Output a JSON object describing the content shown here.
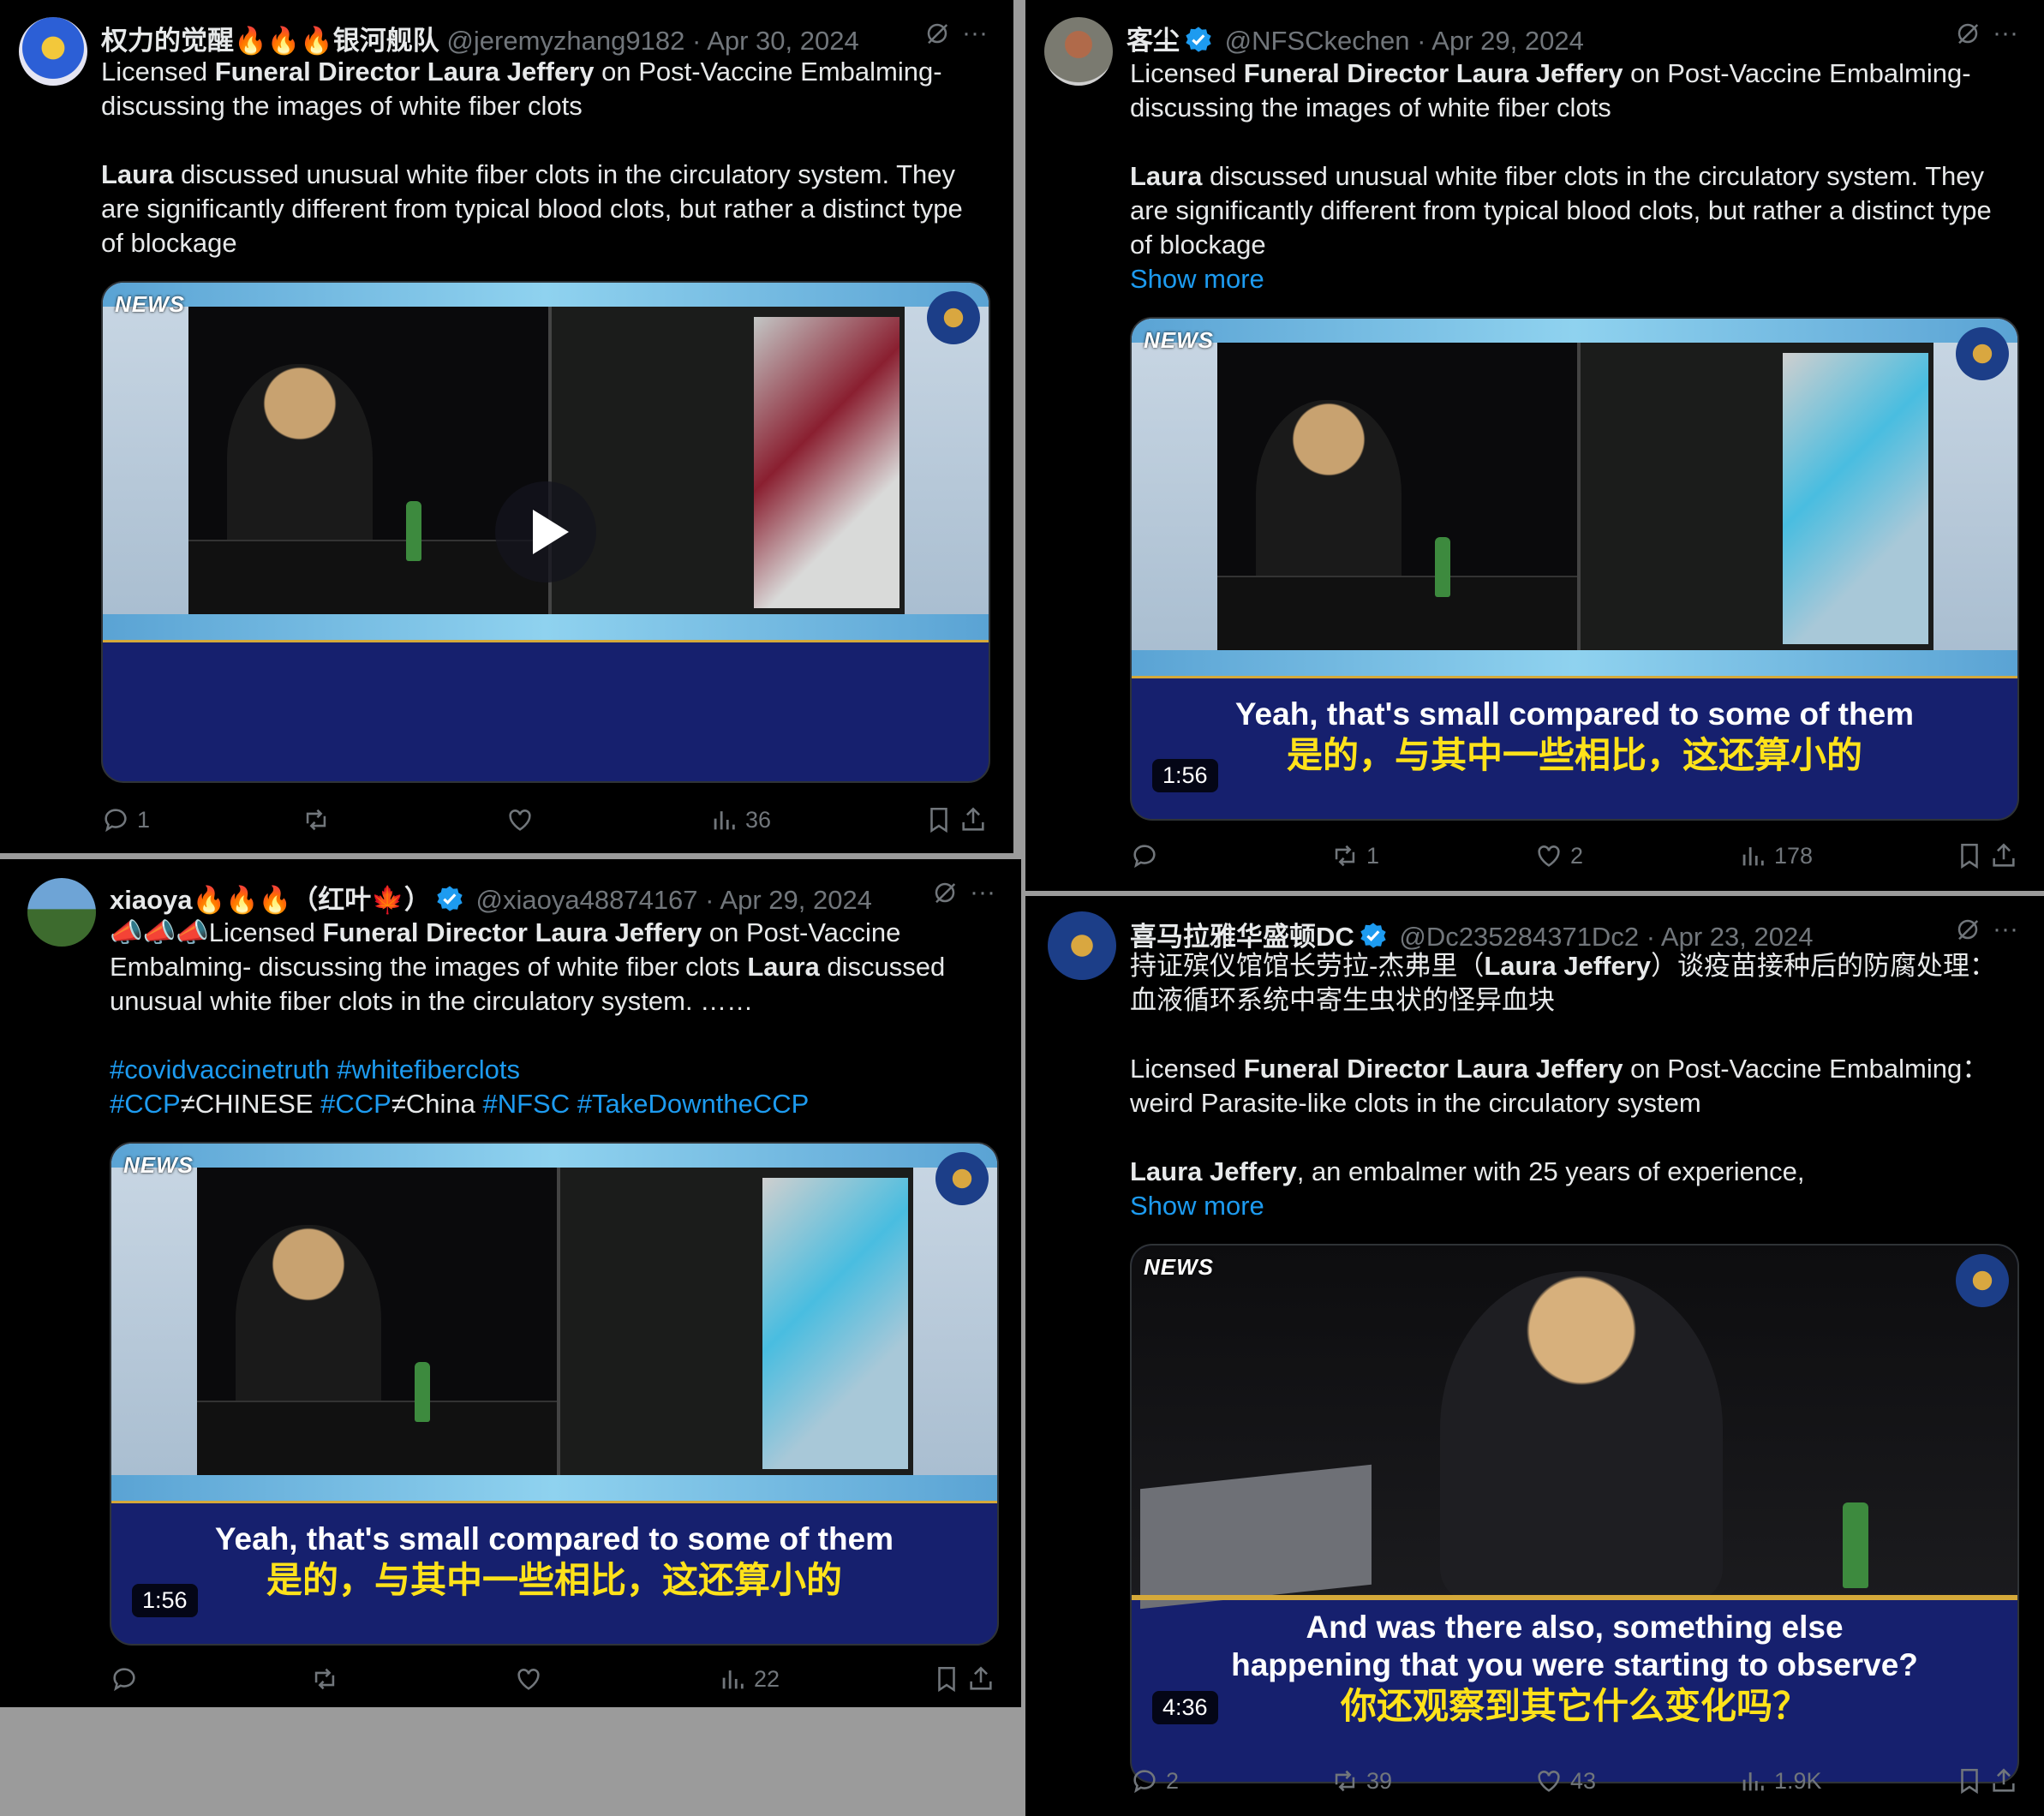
{
  "tweets": [
    {
      "id": "t1",
      "name": "权力的觉醒🔥🔥🔥银河舰队",
      "handle": "@jeremyzhang9182",
      "date": "· Apr 30, 2024",
      "verified": false,
      "line1_pre": "Licensed ",
      "line1_bold": "Funeral Director Laura Jeffery",
      "line1_post": " on Post-Vaccine Embalming- discussing the images of white fiber clots",
      "para2_bold": "Laura",
      "para2_rest": " discussed unusual white fiber clots in the circulatory system. They are significantly different from typical blood clots, but rather a distinct type of blockage",
      "stats": {
        "replies": "1",
        "reposts": "",
        "likes": "",
        "views": "36"
      }
    },
    {
      "id": "t2",
      "name": "客尘",
      "handle": "@NFSCkechen",
      "date": "· Apr 29, 2024",
      "verified": true,
      "line1_pre": "Licensed ",
      "line1_bold": "Funeral Director Laura Jeffery",
      "line1_post": " on Post-Vaccine Embalming- discussing the images of white fiber clots",
      "para2_bold": "Laura",
      "para2_rest": " discussed unusual white fiber clots in the circulatory system. They are significantly different from typical blood clots, but rather a distinct type of blockage",
      "show_more": "Show more",
      "video": {
        "duration": "1:56",
        "sub_en": "Yeah, that's small compared to some of them",
        "sub_zh": "是的，与其中一些相比，这还算小的"
      },
      "stats": {
        "replies": "",
        "reposts": "1",
        "likes": "2",
        "views": "178"
      }
    },
    {
      "id": "t3",
      "name": "xiaoya🔥🔥🔥（红叶🍁）",
      "handle": "@xiaoya48874167",
      "date": "· Apr 29, 2024",
      "verified": true,
      "line1_prefix": "📣📣📣",
      "line1_pre": "Licensed ",
      "line1_bold": "Funeral Director Laura Jeffery",
      "line1_post": " on Post-Vaccine Embalming- discussing the images of white fiber clots  ",
      "line1_bold2": "Laura",
      "line1_post2": " discussed unusual white fiber clots in the circulatory system. ……",
      "hashtags1": [
        "#covidvaccinetruth",
        "#whitefiberclots"
      ],
      "hashtags2_a": "#CCP",
      "hashtags2_b": "≠CHINESE ",
      "hashtags2_c": "#CCP",
      "hashtags2_d": "≠China ",
      "hashtags2_e": "#NFSC",
      "hashtags2_f": "#TakeDowntheCCP",
      "video": {
        "duration": "1:56",
        "sub_en": "Yeah, that's small compared to some of them",
        "sub_zh": "是的，与其中一些相比，这还算小的"
      },
      "stats": {
        "replies": "",
        "reposts": "",
        "likes": "",
        "views": "22"
      }
    },
    {
      "id": "t4",
      "name": "喜马拉雅华盛顿DC",
      "handle": "@Dc235284371Dc2",
      "date": "· Apr 23, 2024",
      "verified": true,
      "zh_pre": "持证殡仪馆馆长劳拉-杰弗里（",
      "zh_bold": "Laura Jeffery",
      "zh_post": "）谈疫苗接种后的防腐处理：血液循环系统中寄生虫状的怪异血块",
      "en_pre": "Licensed ",
      "en_bold": "Funeral Director Laura Jeffery",
      "en_post": " on Post-Vaccine Embalming：weird Parasite-like clots in the circulatory system",
      "p3_bold": "Laura Jeffery",
      "p3_rest": ", an embalmer with 25 years of experience,",
      "show_more": "Show more",
      "video": {
        "duration": "4:36",
        "sub_en1": "And was there also, something else",
        "sub_en2": "happening that you were starting to observe?",
        "sub_zh": "你还观察到其它什么变化吗？"
      },
      "stats": {
        "replies": "2",
        "reposts": "39",
        "likes": "43",
        "views": "1.9K"
      }
    }
  ],
  "gnews_label": "NEWS",
  "colors": {
    "accent": "#1d9bf0",
    "muted": "#71767b",
    "subtitle_zh": "#ffe21a",
    "subtitle_band": "#16206e"
  },
  "icons": [
    "reply-icon",
    "repost-icon",
    "like-icon",
    "views-icon",
    "bookmark-icon",
    "share-icon",
    "grok-icon",
    "more-icon",
    "verified-badge-icon",
    "play-icon"
  ]
}
